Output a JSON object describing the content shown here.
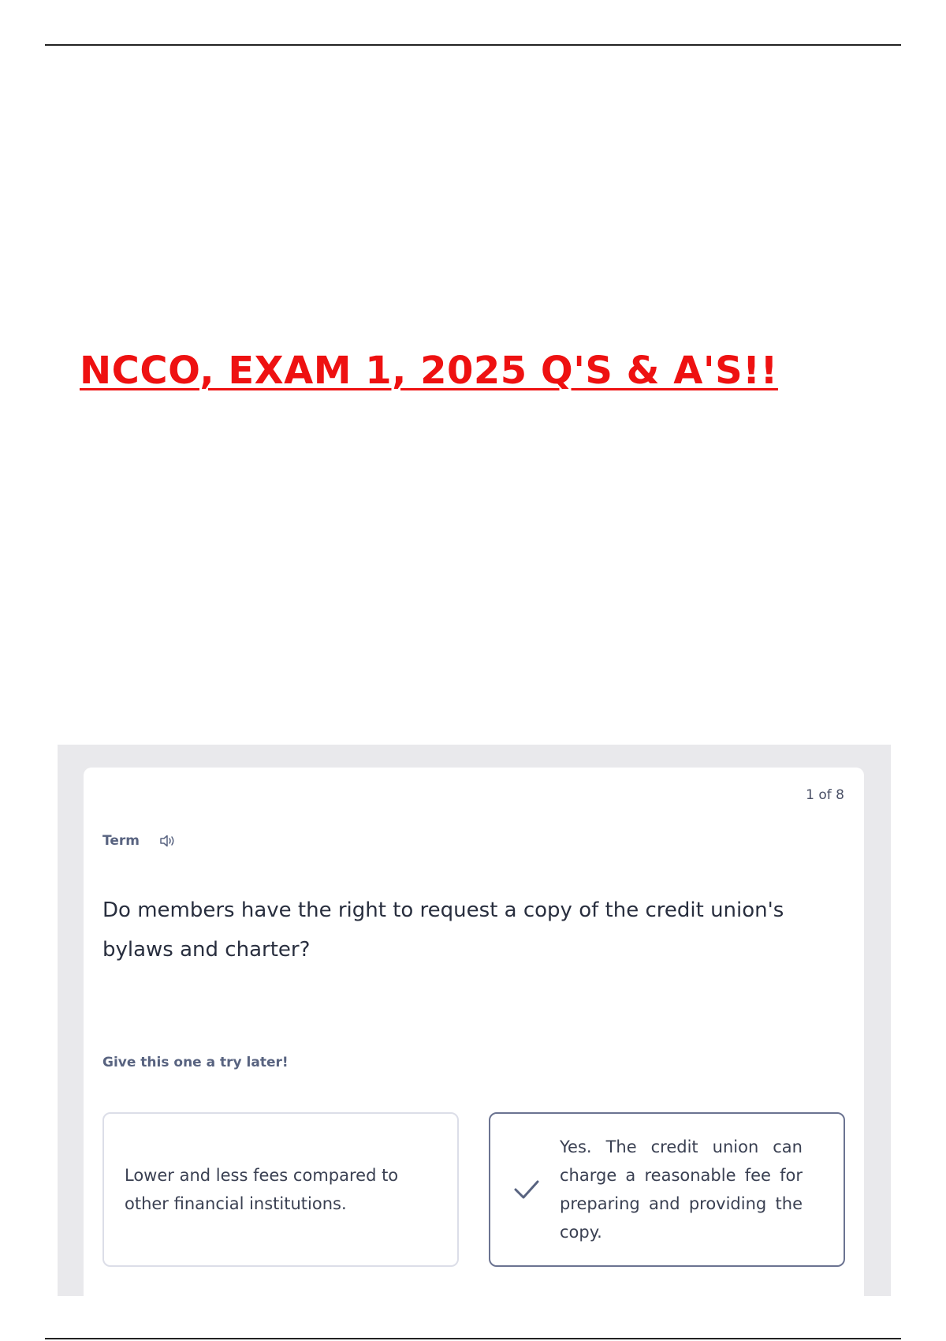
{
  "document": {
    "title": "NCCO, EXAM 1, 2025 Q'S & A'S!!"
  },
  "flashcard": {
    "counter": "1 of 8",
    "term_label": "Term",
    "question": "Do members have the right to request a copy of the credit union's bylaws and charter?",
    "hint": "Give this one a try later!",
    "options": [
      {
        "text": "Lower and less fees compared to other financial institutions.",
        "selected": false
      },
      {
        "text": "Yes. The credit union can charge a reasonable fee for preparing and providing the copy.",
        "selected": true,
        "icon": "check-icon"
      }
    ]
  },
  "colors": {
    "title": "#ee1111",
    "card_frame": "#e9e9ec",
    "selected_border": "#6b7391"
  }
}
